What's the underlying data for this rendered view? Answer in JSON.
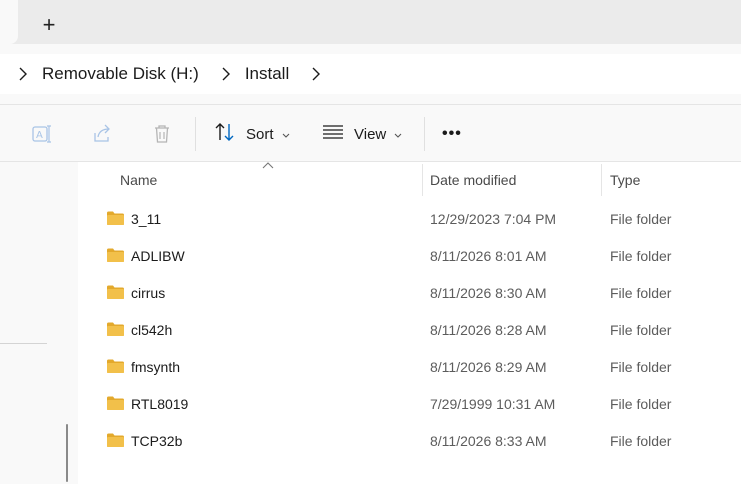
{
  "tabstrip": {
    "new_tab_symbol": "+"
  },
  "breadcrumb": {
    "items": [
      "Removable Disk (H:)",
      "Install"
    ]
  },
  "commandbar": {
    "sort_label": "Sort",
    "view_label": "View",
    "more_label": "•••"
  },
  "columns": {
    "name": "Name",
    "date": "Date modified",
    "type": "Type"
  },
  "files": [
    {
      "name": "3_11",
      "date": "12/29/2023 7:04 PM",
      "type": "File folder"
    },
    {
      "name": "ADLIBW",
      "date": "8/11/2026 8:01 AM",
      "type": "File folder"
    },
    {
      "name": "cirrus",
      "date": "8/11/2026 8:30 AM",
      "type": "File folder"
    },
    {
      "name": "cl542h",
      "date": "8/11/2026 8:28 AM",
      "type": "File folder"
    },
    {
      "name": "fmsynth",
      "date": "8/11/2026 8:29 AM",
      "type": "File folder"
    },
    {
      "name": "RTL8019",
      "date": "7/29/1999 10:31 AM",
      "type": "File folder"
    },
    {
      "name": "TCP32b",
      "date": "8/11/2026 8:33 AM",
      "type": "File folder"
    }
  ],
  "colors": {
    "folder": "#f2c04a",
    "folder_dark": "#e3a92c",
    "accent": "#0067c0"
  }
}
